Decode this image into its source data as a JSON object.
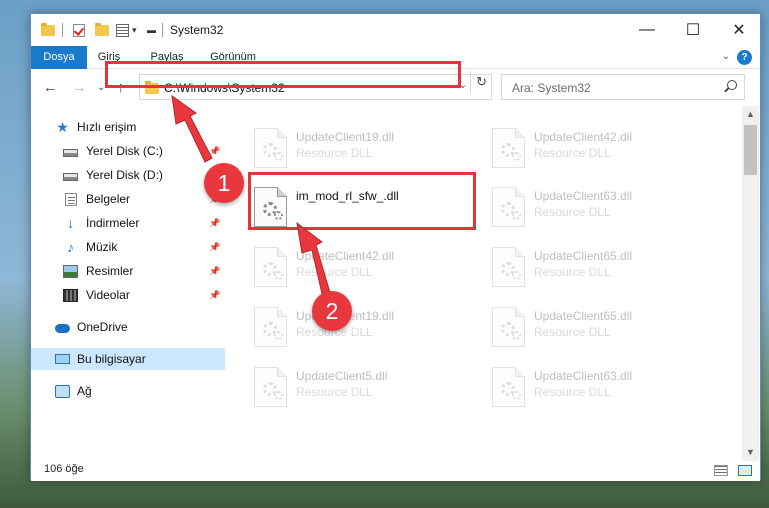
{
  "window": {
    "title": "System32",
    "controls": {
      "minimize": "—",
      "maximize": "☐",
      "close": "✕"
    }
  },
  "ribbon": {
    "tabs": [
      "Dosya",
      "Giriş",
      "Paylaş",
      "Görünüm"
    ],
    "help": "?"
  },
  "address": {
    "path": "C:\\Windows\\System32",
    "search_placeholder": "Ara: System32"
  },
  "sidebar": {
    "items": [
      {
        "label": "Hızlı erişim",
        "icon": "star-icon"
      },
      {
        "label": "Yerel Disk (C:)",
        "icon": "drive-icon"
      },
      {
        "label": "Yerel Disk (D:)",
        "icon": "drive-icon"
      },
      {
        "label": "Belgeler",
        "icon": "document-icon"
      },
      {
        "label": "İndirmeler",
        "icon": "download-icon"
      },
      {
        "label": "Müzik",
        "icon": "music-icon"
      },
      {
        "label": "Resimler",
        "icon": "pictures-icon"
      },
      {
        "label": "Videolar",
        "icon": "video-icon"
      },
      {
        "label": "OneDrive",
        "icon": "cloud-icon"
      },
      {
        "label": "Bu bilgisayar",
        "icon": "computer-icon"
      },
      {
        "label": "Ağ",
        "icon": "network-icon"
      }
    ]
  },
  "files": [
    {
      "name": "UpdateClient19.dll",
      "type": "Resource DLL"
    },
    {
      "name": "UpdateClient42.dll",
      "type": "Resource DLL"
    },
    {
      "name": "im_mod_rl_sfw_.dll",
      "type": ""
    },
    {
      "name": "UpdateClient63.dll",
      "type": "Resource DLL"
    },
    {
      "name": "UpdateClient42.dll",
      "type": "Resource DLL"
    },
    {
      "name": "UpdateClient65.dll",
      "type": "Resource DLL"
    },
    {
      "name": "UpdateClient19.dll",
      "type": "Resource DLL"
    },
    {
      "name": "UpdateClient65.dll",
      "type": "Resource DLL"
    },
    {
      "name": "UpdateClient5.dll",
      "type": "Resource DLL"
    },
    {
      "name": "UpdateClient63.dll",
      "type": "Resource DLL"
    }
  ],
  "status": {
    "item_count": "106 öğe"
  },
  "callouts": {
    "step1": "1",
    "step2": "2"
  },
  "colors": {
    "accent": "#1979ca",
    "highlight": "#e3333c",
    "selection": "#cce8ff"
  }
}
